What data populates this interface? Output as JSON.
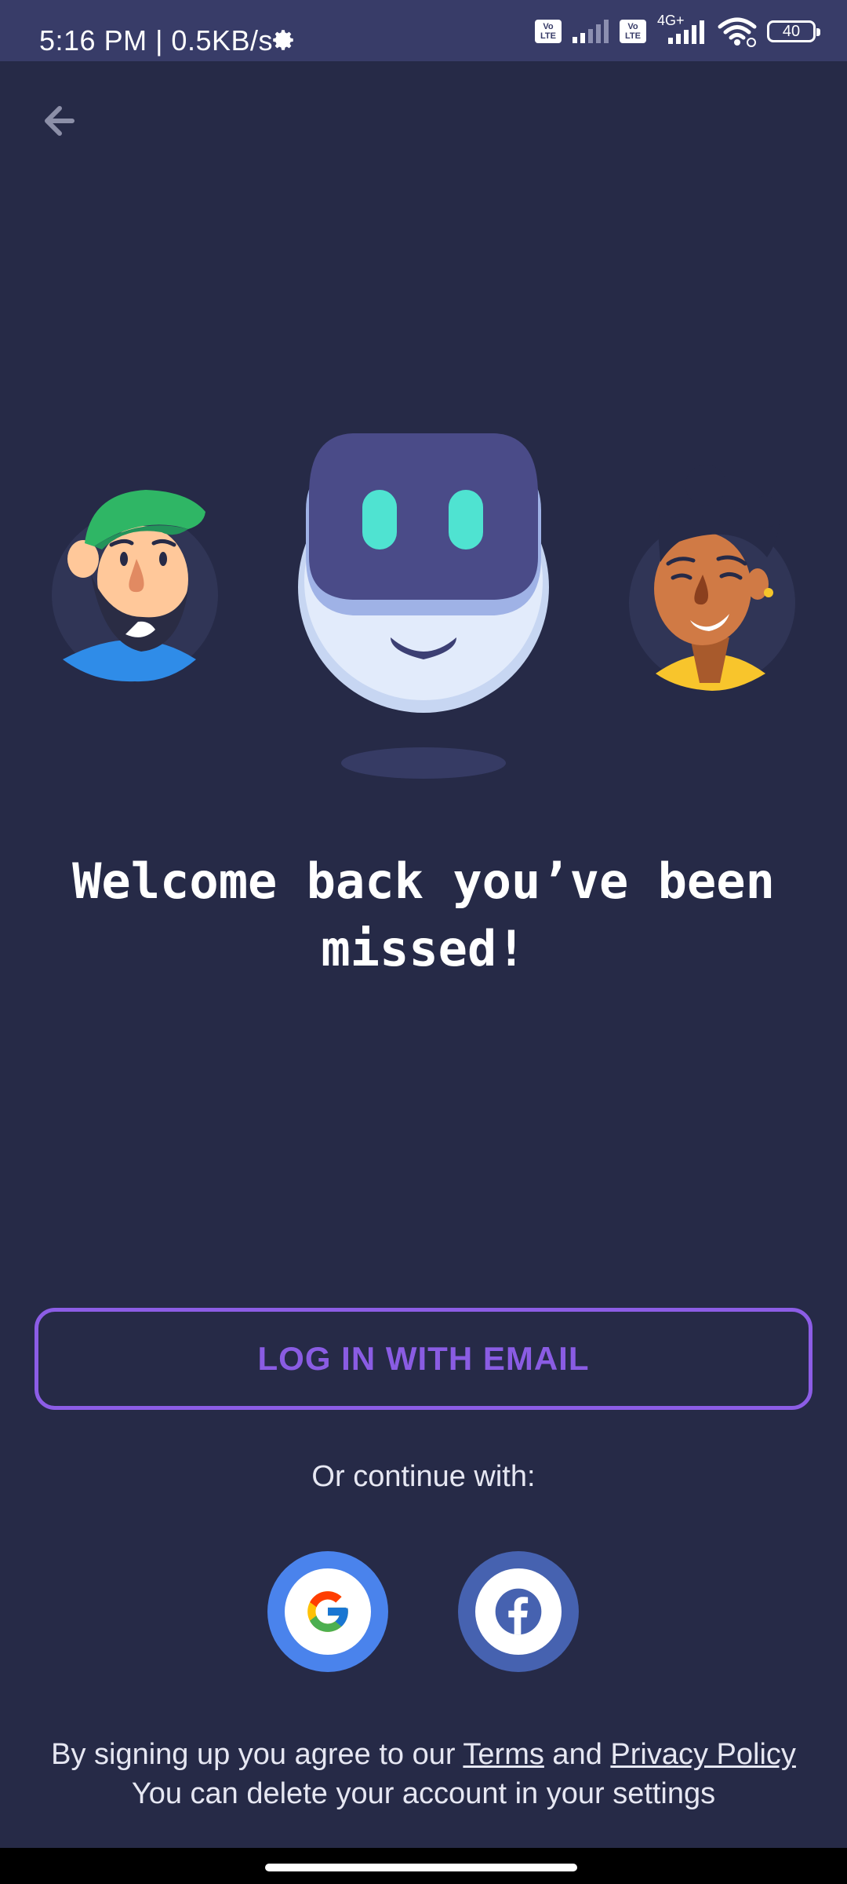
{
  "status_bar": {
    "time_speed": "5:16 PM | 0.5KB/s",
    "volte1_top": "Vo",
    "volte1_bottom": "LTE",
    "volte2_top": "Vo",
    "volte2_bottom": "LTE",
    "network_type": "4G+",
    "battery": "40"
  },
  "main": {
    "title_line1": "Welcome back you’ve been",
    "title_line2": "missed!",
    "email_button": "LOG IN WITH EMAIL",
    "or_text": "Or continue with:",
    "legal_prefix": "By signing up you agree to our ",
    "terms_link": "Terms",
    "legal_and": " and ",
    "privacy_link": "Privacy Policy",
    "legal_line2": "You can delete your account in your settings"
  },
  "colors": {
    "background": "#262a47",
    "accent": "#8c5de6",
    "google": "#4a83ec",
    "facebook": "#4662b0"
  }
}
